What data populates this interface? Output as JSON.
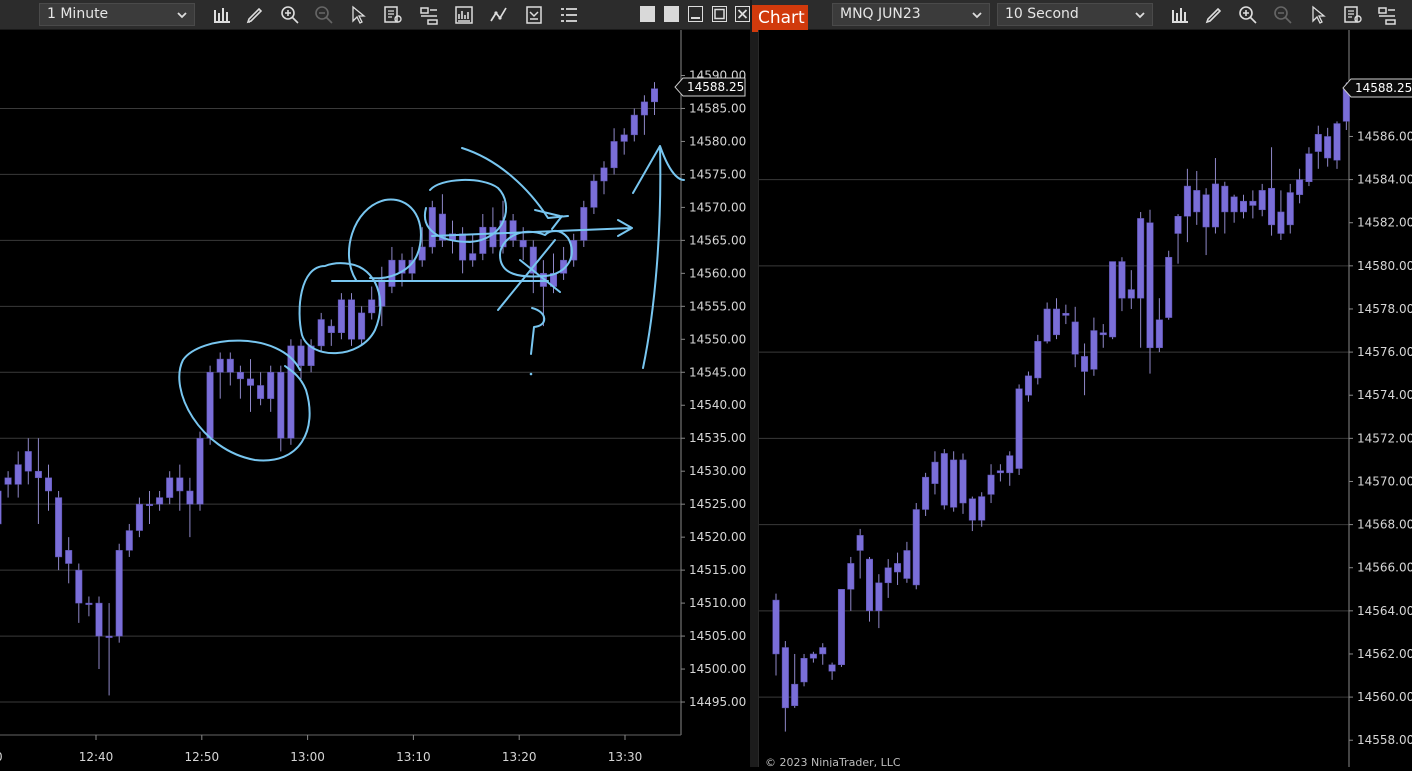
{
  "left_toolbar": {
    "interval": "1 Minute"
  },
  "right_toolbar": {
    "tab_label": "Chart",
    "instrument": "MNQ JUN23",
    "interval": "10 Second"
  },
  "colors": {
    "candle": "#7a6ed8",
    "wick": "#8f88c8",
    "drawing": "#78c6f0",
    "grid": "#3a3a3a"
  },
  "footer": {
    "copyright": "© 2023 NinjaTrader, LLC"
  },
  "chart_data": [
    {
      "type": "candlestick",
      "interval": "1 Minute",
      "current_price_label": "14588.25",
      "ylim": [
        14490,
        14592.5
      ],
      "y_ticks": [
        "14590.00",
        "14585.00",
        "14580.00",
        "14575.00",
        "14570.00",
        "14565.00",
        "14560.00",
        "14555.00",
        "14550.00",
        "14545.00",
        "14540.00",
        "14535.00",
        "14530.00",
        "14525.00",
        "14520.00",
        "14515.00",
        "14510.00",
        "14505.00",
        "14500.00",
        "14495.00"
      ],
      "x_ticks": [
        "12:40",
        "12:50",
        "13:00",
        "13:10",
        "13:20",
        "13:30"
      ],
      "candles": [
        [
          14522,
          14527,
          14519,
          14528
        ],
        [
          14528,
          14529,
          14526,
          14530
        ],
        [
          14528,
          14531,
          14526,
          14533
        ],
        [
          14530,
          14533,
          14528,
          14535
        ],
        [
          14529,
          14530,
          14522,
          14535
        ],
        [
          14527,
          14529,
          14524,
          14531
        ],
        [
          14526,
          14517,
          14515,
          14527
        ],
        [
          14518,
          14516,
          14513,
          14520
        ],
        [
          14515,
          14510,
          14507,
          14516
        ],
        [
          14510,
          14510,
          14508,
          14511
        ],
        [
          14510,
          14505,
          14500,
          14511
        ],
        [
          14505,
          14505,
          14496,
          14510
        ],
        [
          14505,
          14518,
          14504,
          14519
        ],
        [
          14518,
          14521,
          14517,
          14522
        ],
        [
          14521,
          14525,
          14520,
          14526
        ],
        [
          14525,
          14525,
          14522,
          14527
        ],
        [
          14525,
          14526,
          14524,
          14527
        ],
        [
          14526,
          14529,
          14525,
          14530
        ],
        [
          14529,
          14527,
          14524,
          14531
        ],
        [
          14527,
          14525,
          14520,
          14529
        ],
        [
          14525,
          14535,
          14524,
          14536
        ],
        [
          14535,
          14545,
          14534,
          14546
        ],
        [
          14545,
          14547,
          14541,
          14548
        ],
        [
          14547,
          14545,
          14543,
          14548
        ],
        [
          14545,
          14544,
          14541,
          14546
        ],
        [
          14544,
          14543,
          14539,
          14547
        ],
        [
          14543,
          14541,
          14540,
          14545
        ],
        [
          14541,
          14545,
          14539,
          14546
        ],
        [
          14545,
          14535,
          14533,
          14546
        ],
        [
          14535,
          14549,
          14534,
          14550
        ],
        [
          14549,
          14546,
          14544,
          14550
        ],
        [
          14546,
          14549,
          14545,
          14550
        ],
        [
          14549,
          14553,
          14548,
          14554
        ],
        [
          14552,
          14551,
          14549,
          14553
        ],
        [
          14551,
          14556,
          14550,
          14557
        ],
        [
          14556,
          14550,
          14549,
          14557
        ],
        [
          14550,
          14554,
          14549,
          14555
        ],
        [
          14554,
          14556,
          14553,
          14558
        ],
        [
          14555,
          14559,
          14552,
          14561
        ],
        [
          14558,
          14562,
          14557,
          14564
        ],
        [
          14562,
          14560,
          14558,
          14563
        ],
        [
          14560,
          14562,
          14559,
          14564
        ],
        [
          14562,
          14564,
          14561,
          14567
        ],
        [
          14564,
          14570,
          14563,
          14571
        ],
        [
          14569,
          14565,
          14564,
          14572
        ],
        [
          14565,
          14566,
          14563,
          14568
        ],
        [
          14566,
          14562,
          14560,
          14567
        ],
        [
          14562,
          14563,
          14561,
          14566
        ],
        [
          14563,
          14567,
          14562,
          14569
        ],
        [
          14567,
          14564,
          14563,
          14570
        ],
        [
          14564,
          14568,
          14563,
          14571
        ],
        [
          14568,
          14565,
          14564,
          14569
        ],
        [
          14565,
          14564,
          14562,
          14567
        ],
        [
          14564,
          14560,
          14557,
          14565
        ],
        [
          14560,
          14558,
          14552,
          14562
        ],
        [
          14558,
          14560,
          14557,
          14563
        ],
        [
          14560,
          14562,
          14559,
          14564
        ],
        [
          14562,
          14565,
          14561,
          14566
        ],
        [
          14565,
          14570,
          14564,
          14571
        ],
        [
          14570,
          14574,
          14569,
          14575
        ],
        [
          14574,
          14576,
          14572,
          14577
        ],
        [
          14576,
          14580,
          14575,
          14582
        ],
        [
          14580,
          14581,
          14578,
          14582
        ],
        [
          14581,
          14584,
          14580,
          14585
        ],
        [
          14584,
          14586,
          14581,
          14587
        ],
        [
          14586,
          14588,
          14584,
          14589
        ]
      ]
    },
    {
      "type": "candlestick",
      "instrument": "MNQ JUN23",
      "interval": "10 Second",
      "current_price_label": "14588.25",
      "ylim": [
        14557.5,
        14589.5
      ],
      "y_ticks": [
        "14586.00",
        "14584.00",
        "14582.00",
        "14580.00",
        "14578.00",
        "14576.00",
        "14574.00",
        "14572.00",
        "14570.00",
        "14568.00",
        "14566.00",
        "14564.00",
        "14562.00",
        "14560.00",
        "14558.00"
      ],
      "candles": [
        [
          14564.5,
          14562,
          14561,
          14564.8
        ],
        [
          14562.3,
          14559.5,
          14558.4,
          14562.6
        ],
        [
          14559.6,
          14560.6,
          14559.5,
          14562
        ],
        [
          14560.7,
          14561.8,
          14560.5,
          14562
        ],
        [
          14561.8,
          14562,
          14561.6,
          14562.1
        ],
        [
          14562,
          14562.3,
          14561.5,
          14562.5
        ],
        [
          14561.5,
          14561.2,
          14560.8,
          14561.6
        ],
        [
          14561.5,
          14565,
          14561.4,
          14565
        ],
        [
          14565,
          14566.2,
          14564,
          14566.5
        ],
        [
          14566.8,
          14567.5,
          14565.5,
          14567.8
        ],
        [
          14566.4,
          14564,
          14563.5,
          14566.5
        ],
        [
          14564,
          14565.3,
          14563.2,
          14565.7
        ],
        [
          14565.3,
          14566,
          14564.6,
          14566.4
        ],
        [
          14565.8,
          14566.2,
          14565.2,
          14566.7
        ],
        [
          14565.5,
          14566.8,
          14565.3,
          14567.2
        ],
        [
          14565.2,
          14568.7,
          14565,
          14569
        ],
        [
          14568.7,
          14570.2,
          14568.4,
          14570.4
        ],
        [
          14569.9,
          14570.9,
          14569.4,
          14571.4
        ],
        [
          14568.9,
          14571.3,
          14568.7,
          14571.5
        ],
        [
          14568.8,
          14571,
          14568.6,
          14571.4
        ],
        [
          14571,
          14569,
          14568.5,
          14571.3
        ],
        [
          14569.2,
          14568.2,
          14567.7,
          14569.3
        ],
        [
          14568.2,
          14569.3,
          14567.9,
          14569.5
        ],
        [
          14569.4,
          14570.3,
          14569,
          14570.8
        ],
        [
          14570.4,
          14570.5,
          14570,
          14570.8
        ],
        [
          14570.4,
          14571.2,
          14569.8,
          14571.4
        ],
        [
          14570.6,
          14574.3,
          14570.3,
          14574.5
        ],
        [
          14574,
          14574.9,
          14573.7,
          14575.1
        ],
        [
          14574.8,
          14576.5,
          14574.5,
          14576.8
        ],
        [
          14576.5,
          14578,
          14576.4,
          14578.3
        ],
        [
          14576.8,
          14578,
          14576.6,
          14578.5
        ],
        [
          14577.7,
          14577.8,
          14577.3,
          14578.2
        ],
        [
          14577.4,
          14575.9,
          14575.3,
          14578.1
        ],
        [
          14575.8,
          14575.1,
          14574,
          14576.4
        ],
        [
          14575.2,
          14577,
          14574.9,
          14577.6
        ],
        [
          14576.8,
          14576.9,
          14576.2,
          14577.3
        ],
        [
          14576.7,
          14580.2,
          14576.6,
          14580.2
        ],
        [
          14580.2,
          14578.5,
          14577.9,
          14580.4
        ],
        [
          14578.5,
          14578.9,
          14578,
          14579.8
        ],
        [
          14578.5,
          14582.2,
          14576.2,
          14582.5
        ],
        [
          14582,
          14576.2,
          14575,
          14582.6
        ],
        [
          14577.5,
          14576.2,
          14576,
          14578.5
        ],
        [
          14580.4,
          14577.6,
          14577.5,
          14580.7
        ],
        [
          14581.5,
          14582.3,
          14580.1,
          14582.4
        ],
        [
          14582.3,
          14583.7,
          14581.1,
          14584.5
        ],
        [
          14583.5,
          14582.5,
          14581.9,
          14584.4
        ],
        [
          14581.8,
          14583.3,
          14580.5,
          14583.6
        ],
        [
          14581.8,
          14583.8,
          14581.5,
          14585
        ],
        [
          14583.7,
          14582.5,
          14581.5,
          14583.9
        ],
        [
          14582.5,
          14583.2,
          14582,
          14583.3
        ],
        [
          14582.5,
          14583,
          14582.2,
          14583.3
        ],
        [
          14583,
          14582.8,
          14582.2,
          14583.5
        ],
        [
          14582.6,
          14583.5,
          14582.3,
          14583.8
        ],
        [
          14583.6,
          14581.9,
          14581.4,
          14585.5
        ],
        [
          14582.5,
          14581.5,
          14581.2,
          14583.5
        ],
        [
          14581.9,
          14583.4,
          14581.5,
          14583.8
        ],
        [
          14583.3,
          14584,
          14582.9,
          14584.5
        ],
        [
          14583.9,
          14585.2,
          14583.7,
          14585.5
        ],
        [
          14585.3,
          14586.1,
          14584.5,
          14586.5
        ],
        [
          14586,
          14585,
          14584.6,
          14586.4
        ],
        [
          14584.9,
          14586.6,
          14584.5,
          14586.7
        ],
        [
          14586.7,
          14588.2,
          14586.3,
          14588.5
        ]
      ]
    }
  ]
}
